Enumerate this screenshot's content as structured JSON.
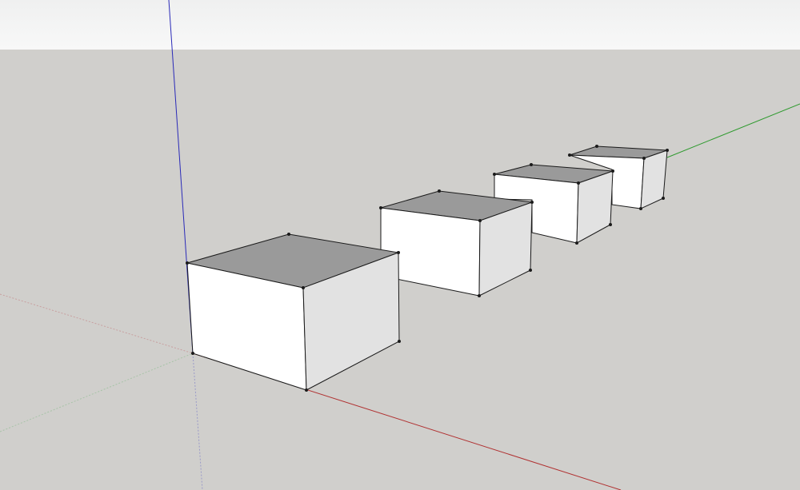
{
  "viewport": {
    "sky_color": "#eff0f0",
    "ground_color": "#d0cfcc",
    "axis_colors": {
      "red": "#b03030",
      "green": "#2e9a2e",
      "blue": "#2a2ab8"
    },
    "face_colors": {
      "top": "#9a9a9a",
      "front": "#ffffff",
      "side": "#e2e2e2",
      "edge": "#1a1a1a"
    },
    "box_count": 4
  }
}
